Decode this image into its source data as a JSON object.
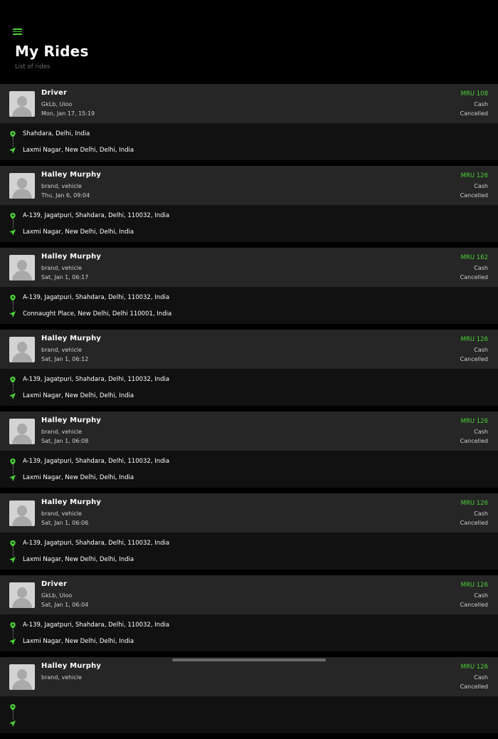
{
  "header": {
    "title": "My Rides",
    "subtitle": "List of rides",
    "menu_icon": "hamburger-menu-icon"
  },
  "colors": {
    "accent": "#4cd137",
    "background": "#000000",
    "card_top": "#262626",
    "card_bottom": "#111111"
  },
  "rides": [
    {
      "driver": "Driver",
      "vehicle": "GkLb, Uioo",
      "date": "Mon, Jan 17, 15:19",
      "fare": "MRU 108",
      "payment": "Cash",
      "status": "Cancelled",
      "pickup": "Shahdara, Delhi, India",
      "drop": "Laxmi Nagar, New Delhi, Delhi, India"
    },
    {
      "driver": "Halley Murphy",
      "vehicle": "brand, vehicle",
      "date": "Thu, Jan 6, 09:04",
      "fare": "MRU 126",
      "payment": "Cash",
      "status": "Cancelled",
      "pickup": "A-139, Jagatpuri, Shahdara, Delhi, 110032, India",
      "drop": "Laxmi Nagar, New Delhi, Delhi, India"
    },
    {
      "driver": "Halley Murphy",
      "vehicle": "brand, vehicle",
      "date": "Sat, Jan 1, 06:17",
      "fare": "MRU 162",
      "payment": "Cash",
      "status": "Cancelled",
      "pickup": "A-139, Jagatpuri, Shahdara, Delhi, 110032, India",
      "drop": "Connaught Place, New Delhi, Delhi 110001, India"
    },
    {
      "driver": "Halley Murphy",
      "vehicle": "brand, vehicle",
      "date": "Sat, Jan 1, 06:12",
      "fare": "MRU 126",
      "payment": "Cash",
      "status": "Cancelled",
      "pickup": "A-139, Jagatpuri, Shahdara, Delhi, 110032, India",
      "drop": "Laxmi Nagar, New Delhi, Delhi, India"
    },
    {
      "driver": "Halley Murphy",
      "vehicle": "brand, vehicle",
      "date": "Sat, Jan 1, 06:08",
      "fare": "MRU 126",
      "payment": "Cash",
      "status": "Cancelled",
      "pickup": "A-139, Jagatpuri, Shahdara, Delhi, 110032, India",
      "drop": "Laxmi Nagar, New Delhi, Delhi, India"
    },
    {
      "driver": "Halley Murphy",
      "vehicle": "brand, vehicle",
      "date": "Sat, Jan 1, 06:06",
      "fare": "MRU 126",
      "payment": "Cash",
      "status": "Cancelled",
      "pickup": "A-139, Jagatpuri, Shahdara, Delhi, 110032, India",
      "drop": "Laxmi Nagar, New Delhi, Delhi, India"
    },
    {
      "driver": "Driver",
      "vehicle": "GkLb, Uioo",
      "date": "Sat, Jan 1, 06:04",
      "fare": "MRU 126",
      "payment": "Cash",
      "status": "Cancelled",
      "pickup": "A-139, Jagatpuri, Shahdara, Delhi, 110032, India",
      "drop": "Laxmi Nagar, New Delhi, Delhi, India"
    },
    {
      "driver": "Halley Murphy",
      "vehicle": "brand, vehicle",
      "date": "",
      "fare": "MRU 126",
      "payment": "Cash",
      "status": "Cancelled",
      "pickup": "",
      "drop": ""
    }
  ]
}
